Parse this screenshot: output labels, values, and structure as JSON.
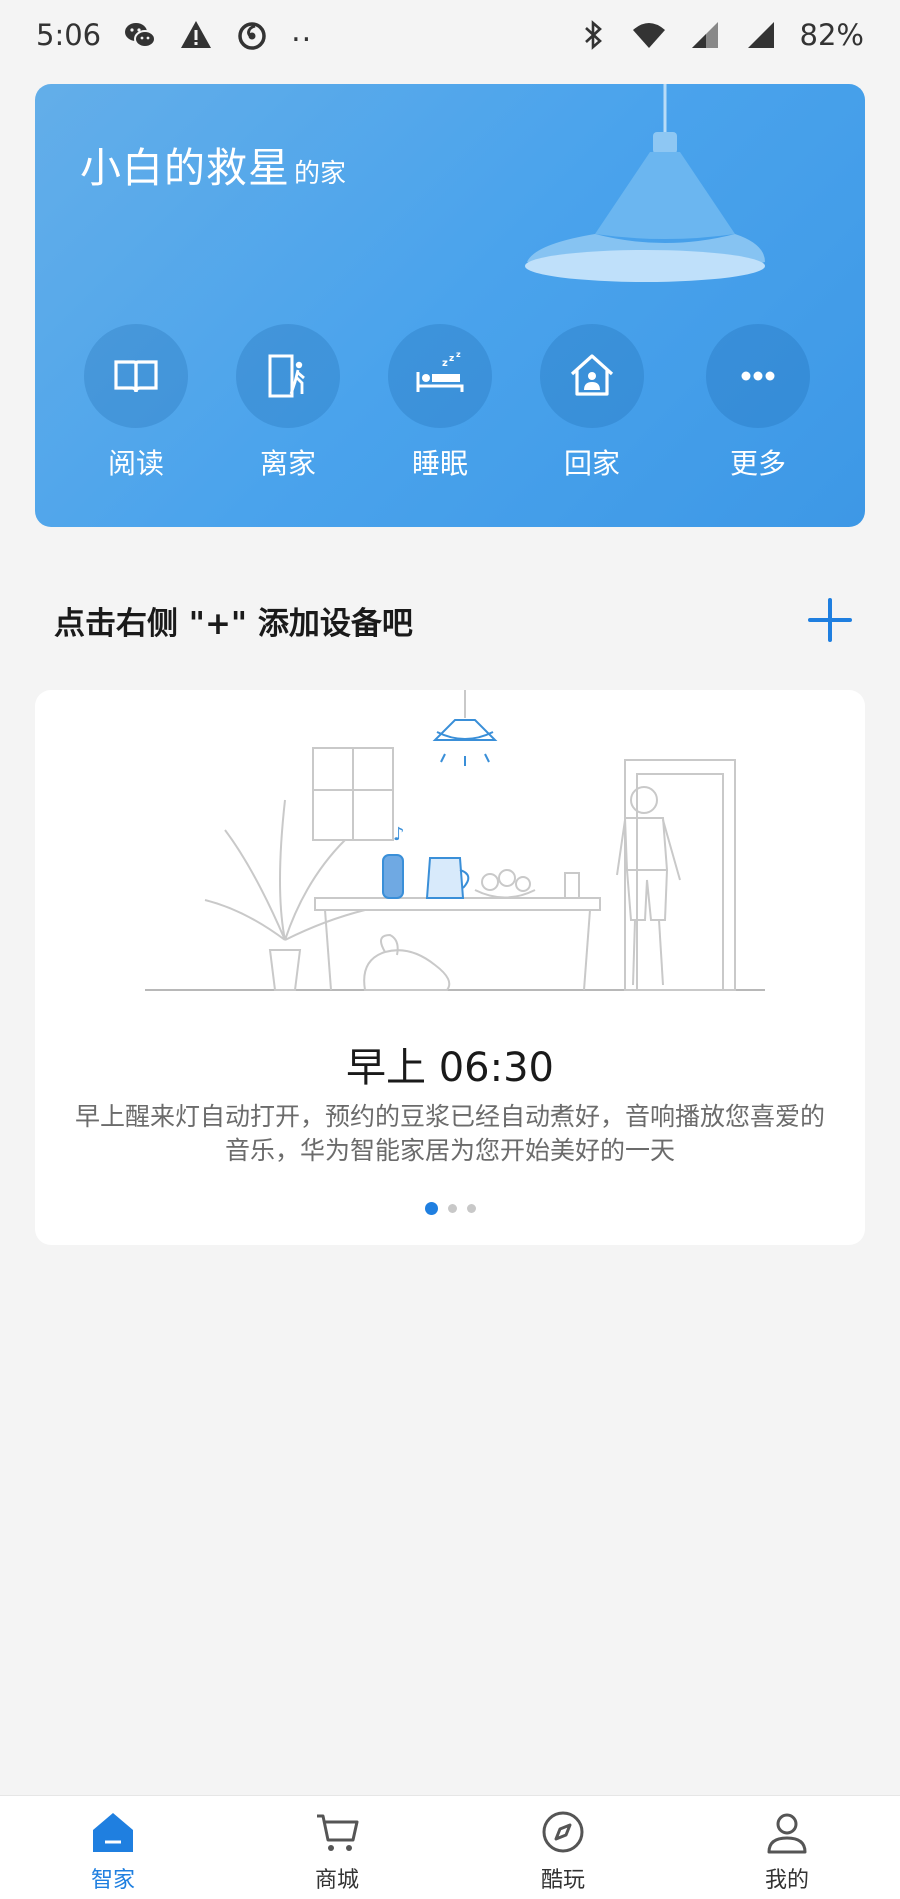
{
  "status_bar": {
    "time": "5:06",
    "left_icons": [
      "wechat-icon",
      "warning-icon",
      "netease-music-icon"
    ],
    "dots": "..",
    "right_icons": [
      "bluetooth-icon",
      "wifi-icon",
      "signal-icon",
      "signal-icon"
    ],
    "battery": "82%"
  },
  "home": {
    "name": "小白的救星",
    "suffix": "的家",
    "scenes": [
      {
        "label": "阅读",
        "icon": "book-icon"
      },
      {
        "label": "离家",
        "icon": "leave-home-icon"
      },
      {
        "label": "睡眠",
        "icon": "sleep-icon"
      },
      {
        "label": "回家",
        "icon": "return-home-icon"
      },
      {
        "label": "更多",
        "icon": "more-icon"
      }
    ]
  },
  "add_device": {
    "prompt": "点击右侧 \"+\" 添加设备吧",
    "icon": "plus-icon"
  },
  "guide": {
    "title": "早上 06:30",
    "description": "早上醒来灯自动打开，预约的豆浆已经自动煮好，音响播放您喜爱的音乐，华为智能家居为您开始美好的一天",
    "page_index": 1,
    "page_count": 3
  },
  "bottom_nav": {
    "items": [
      {
        "label": "智家",
        "icon": "home-icon",
        "active": true
      },
      {
        "label": "商城",
        "icon": "cart-icon",
        "active": false
      },
      {
        "label": "酷玩",
        "icon": "compass-icon",
        "active": false
      },
      {
        "label": "我的",
        "icon": "profile-icon",
        "active": false
      }
    ]
  },
  "colors": {
    "accent": "#1f7fe0",
    "banner": "#4aa3ec",
    "background": "#f4f4f4"
  }
}
